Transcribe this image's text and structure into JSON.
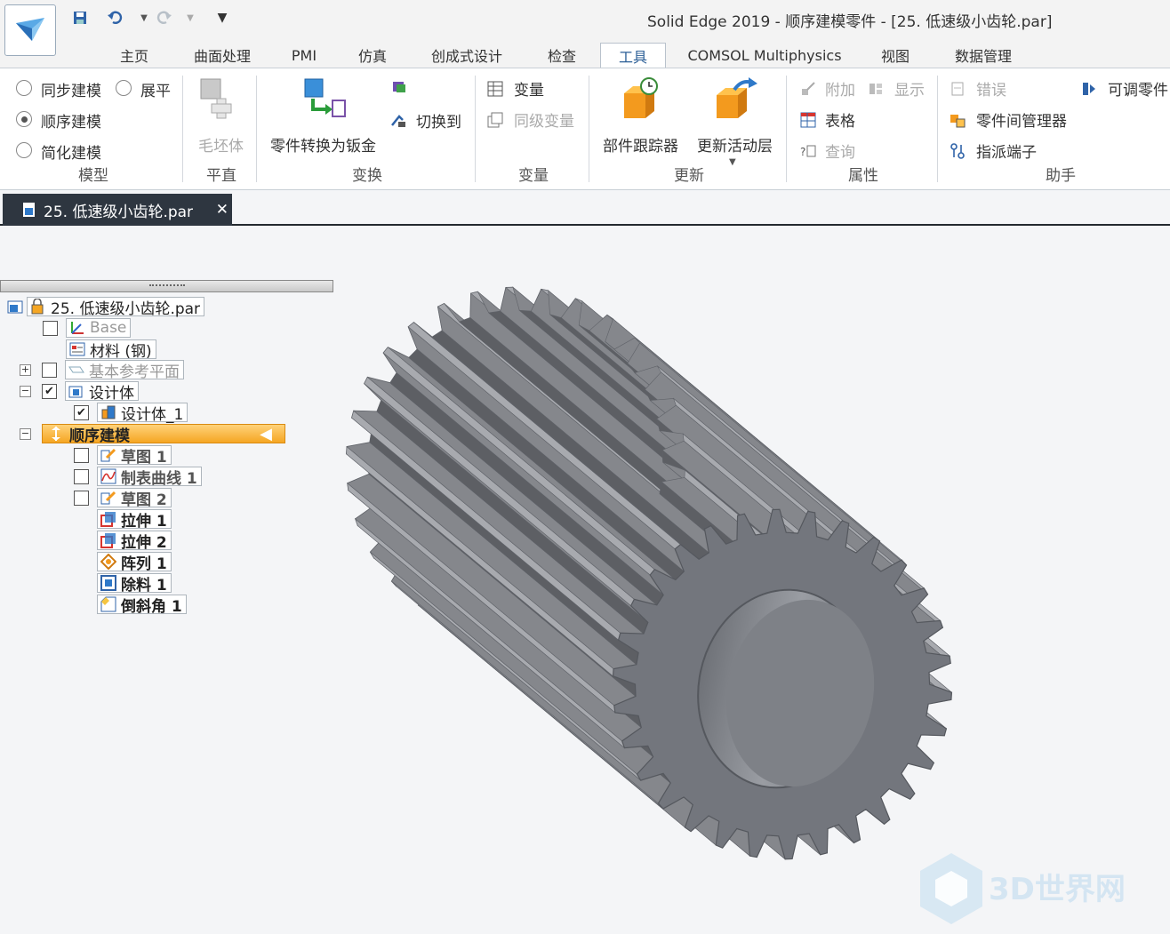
{
  "window": {
    "title": "Solid Edge 2019 - 顺序建模零件 - [25. 低速级小齿轮.par]"
  },
  "menu_tabs": [
    "主页",
    "曲面处理",
    "PMI",
    "仿真",
    "创成式设计",
    "检查",
    "工具",
    "COMSOL Multiphysics",
    "视图",
    "数据管理"
  ],
  "active_tab": "工具",
  "ribbon": {
    "model": {
      "sync": "同步建模",
      "flatten": "展平",
      "ordered": "顺序建模",
      "simplified": "简化建模",
      "label": "模型",
      "selected": "顺序建模"
    },
    "flat": {
      "blank": "毛坯体",
      "label": "平直"
    },
    "transform": {
      "to_sheet": "零件转换为钣金",
      "switch": "切换到",
      "label": "变换"
    },
    "variables": {
      "var": "变量",
      "peer": "同级变量",
      "label": "变量"
    },
    "update": {
      "tracker": "部件跟踪器",
      "active_layer": "更新活动层",
      "label": "更新"
    },
    "properties": {
      "attach": "附加",
      "show": "显示",
      "table": "表格",
      "query": "查询",
      "label": "属性"
    },
    "assistant": {
      "error": "错误",
      "adjustable": "可调零件",
      "inter_part": "零件间管理器",
      "assign_port": "指派端子",
      "label": "助手"
    }
  },
  "doc_tab": {
    "name": "25. 低速级小齿轮.par",
    "close": "✕"
  },
  "pathfinder": {
    "root": "25. 低速级小齿轮.par",
    "base": "Base",
    "material": "材料 (钢)",
    "ref_planes": "基本参考平面",
    "design_body": "设计体",
    "design_body_1": "设计体_1",
    "ordered": "顺序建模",
    "features": [
      "草图 1",
      "制表曲线 1",
      "草图 2",
      "拉伸 1",
      "拉伸 2",
      "阵列 1",
      "除料 1",
      "倒斜角 1"
    ]
  },
  "watermark": "3D世界网",
  "colors": {
    "accent": "#2b5e96",
    "highlight": "#f5a623",
    "gear": "#7b7e85"
  }
}
